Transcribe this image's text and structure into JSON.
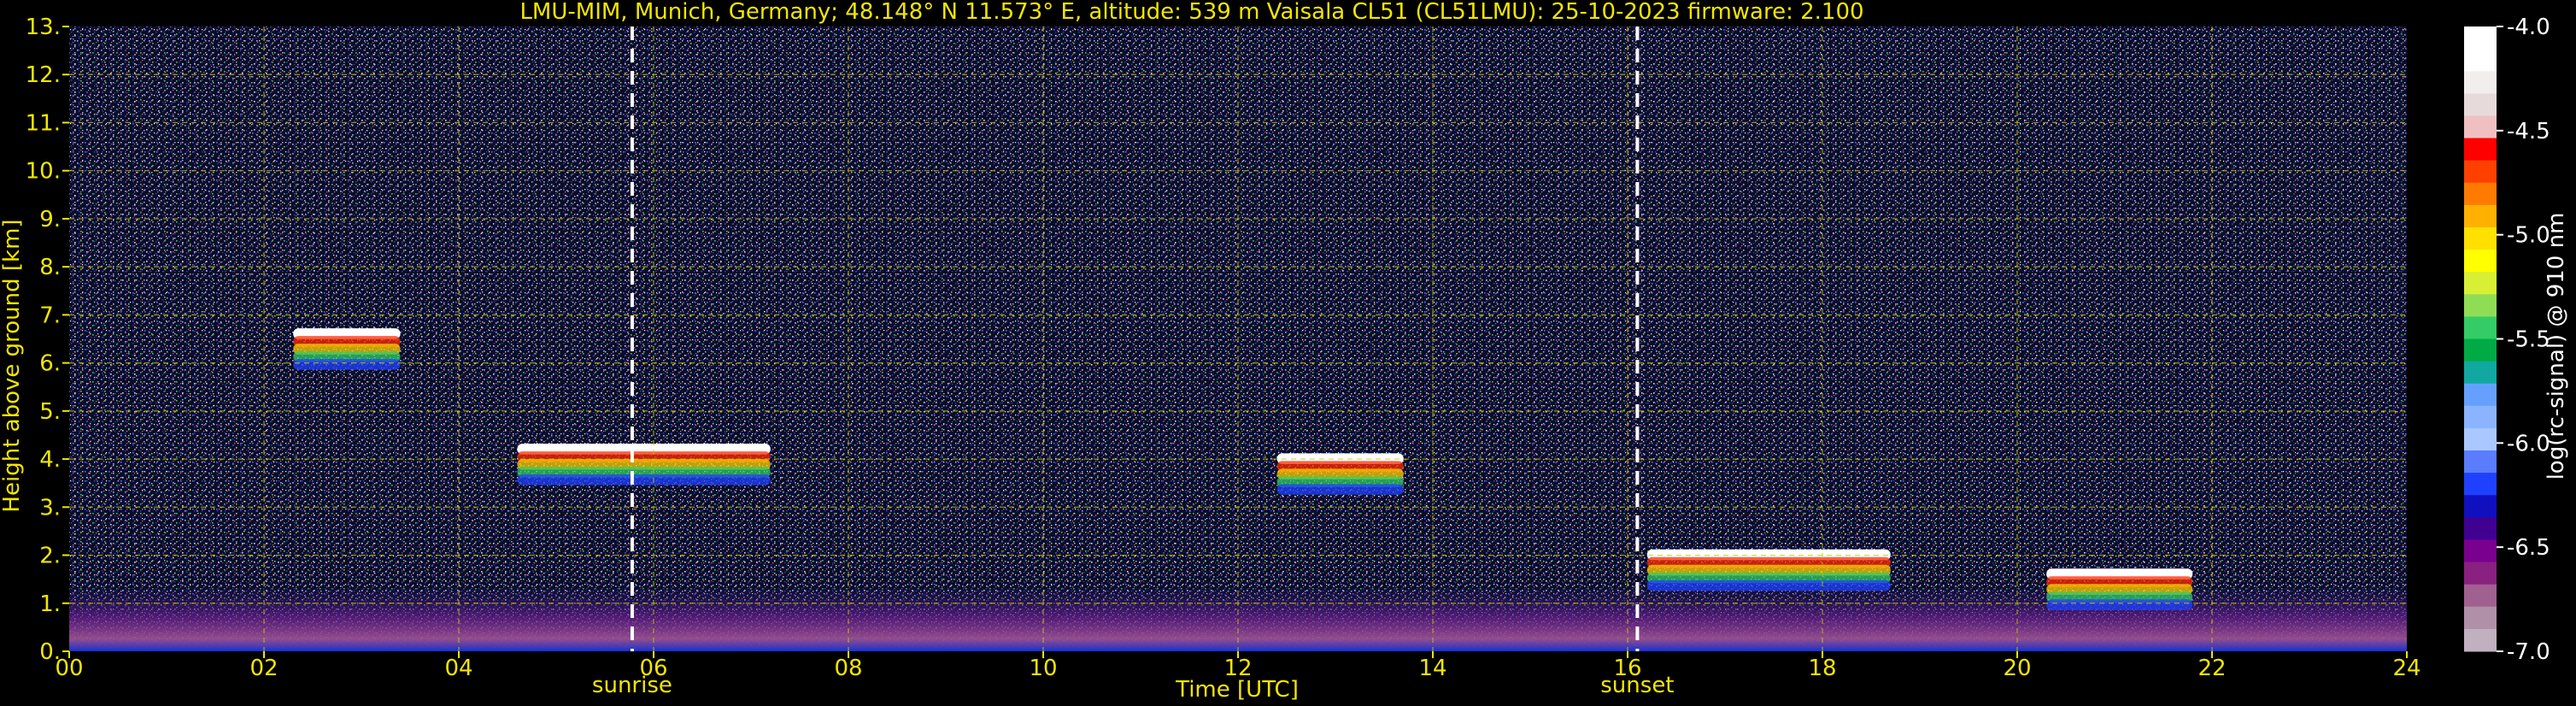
{
  "chart_data": {
    "type": "heatmap",
    "title": "LMU-MIM, Munich, Germany; 48.148° N 11.573° E, altitude: 539 m    Vaisala CL51 (CL51LMU): 25-10-2023    firmware: 2.100",
    "xlabel": "Time [UTC]",
    "ylabel": "Height above ground [km]",
    "xlim": [
      0,
      24
    ],
    "ylim": [
      0,
      13
    ],
    "x_ticks": [
      "00",
      "02",
      "04",
      "06",
      "08",
      "10",
      "12",
      "14",
      "16",
      "18",
      "20",
      "22",
      "24"
    ],
    "y_ticks": [
      "0.",
      "1.",
      "2.",
      "3.",
      "4.",
      "5.",
      "6.",
      "7.",
      "8.",
      "9.",
      "10.",
      "11.",
      "12.",
      "13."
    ],
    "grid": true,
    "events": [
      {
        "label": "sunrise",
        "time": 5.78
      },
      {
        "label": "sunset",
        "time": 16.1
      }
    ],
    "colorbar": {
      "label": "log(rc-signal) @ 910 nm",
      "range": [
        -7.0,
        -4.0
      ],
      "ticks": [
        "-4.0",
        "-4.5",
        "-5.0",
        "-5.5",
        "-6.0",
        "-6.5",
        "-7.0"
      ],
      "colors": [
        "#ffffff",
        "#ffffff",
        "#f3eeee",
        "#e6dada",
        "#f0c0c0",
        "#ff0000",
        "#ff4000",
        "#ff7a00",
        "#ffb000",
        "#ffe000",
        "#ffff00",
        "#d8ef35",
        "#8fdd55",
        "#33cc66",
        "#00aa44",
        "#10a8a0",
        "#66a0ff",
        "#8ab4ff",
        "#aac8ff",
        "#5a7cff",
        "#2040ff",
        "#1010c0",
        "#400090",
        "#7a0090",
        "#8a2080",
        "#a06090",
        "#b090a8",
        "#c0b0c0"
      ]
    },
    "layers": [
      {
        "name": "surface aerosol layer",
        "time_start": 0,
        "time_end": 24,
        "height_top": 0.6
      },
      {
        "name": "cloud",
        "time_start": 4.6,
        "time_end": 7.2,
        "height": 4.0
      },
      {
        "name": "cloud",
        "time_start": 12.4,
        "time_end": 13.7,
        "height": 3.8
      },
      {
        "name": "cloud",
        "time_start": 2.3,
        "time_end": 3.4,
        "height": 6.4
      },
      {
        "name": "cloud",
        "time_start": 16.2,
        "time_end": 18.7,
        "height": 1.8
      },
      {
        "name": "cloud",
        "time_start": 20.3,
        "time_end": 21.8,
        "height": 1.4
      }
    ]
  }
}
